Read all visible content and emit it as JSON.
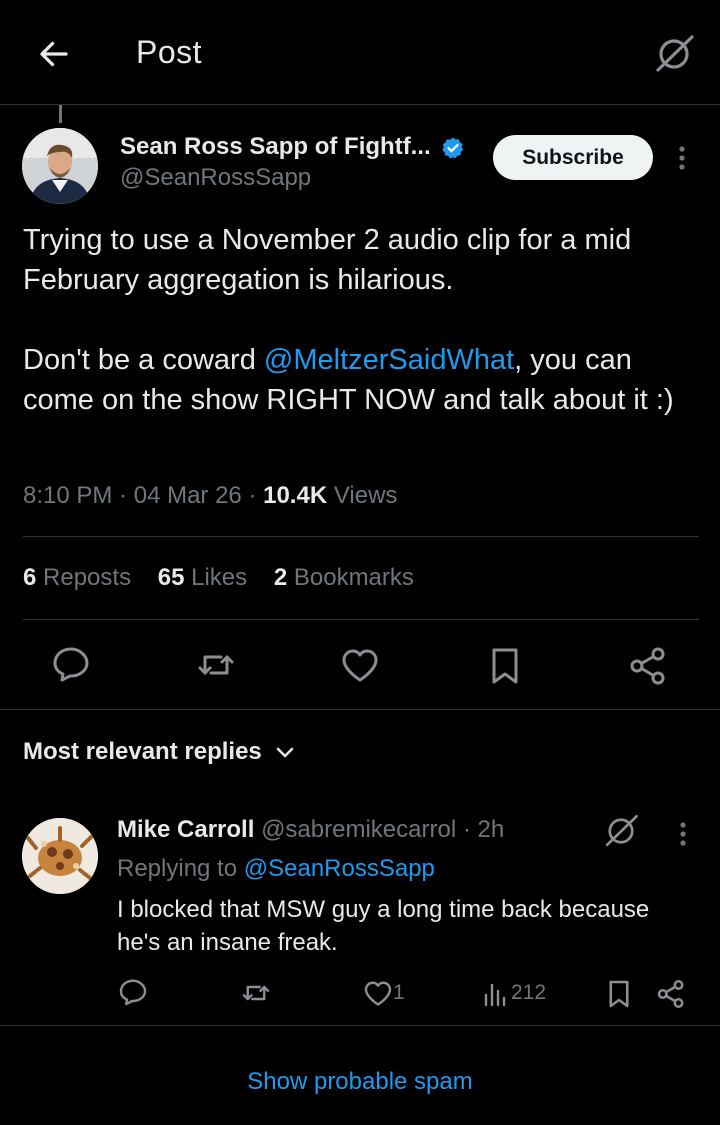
{
  "header": {
    "title": "Post",
    "back_icon": "arrow-left-icon",
    "grok_icon": "grok-icon"
  },
  "post": {
    "author_name": "Sean Ross Sapp of Fightf...",
    "author_handle": "@SeanRossSapp",
    "verified_color": "#1d9bf0",
    "subscribe_label": "Subscribe",
    "text_para1": "Trying to use a November 2 audio clip for a mid February aggregation is hilarious.",
    "text_para2_before": "Don't be a coward ",
    "text_para2_mention": "@MeltzerSaidWhat",
    "text_para2_after": ", you can come on the show RIGHT NOW and talk about it :)",
    "time": "8:10 PM",
    "date": "04 Mar 26",
    "views_count": "10.4K",
    "views_label": "Views",
    "reposts_count": "6",
    "reposts_label": "Reposts",
    "likes_count": "65",
    "likes_label": "Likes",
    "bookmarks_count": "2",
    "bookmarks_label": "Bookmarks",
    "actions": [
      "reply-icon",
      "repost-icon",
      "like-icon",
      "bookmark-icon",
      "share-icon"
    ]
  },
  "replies_filter": {
    "label": "Most relevant replies"
  },
  "reply": {
    "name": "Mike Carroll",
    "handle": "@sabremikecarrol",
    "age": "2h",
    "replying_label": "Replying to",
    "replying_to": "@SeanRossSapp",
    "text": "I blocked that MSW guy a long time back because he's an insane freak.",
    "likes": "1",
    "views": "212"
  },
  "spam_link": "Show probable spam",
  "colors": {
    "background": "#000000",
    "text": "#e7e9ea",
    "muted": "#71767b",
    "accent": "#1d9bf0",
    "border": "#2f3336"
  }
}
